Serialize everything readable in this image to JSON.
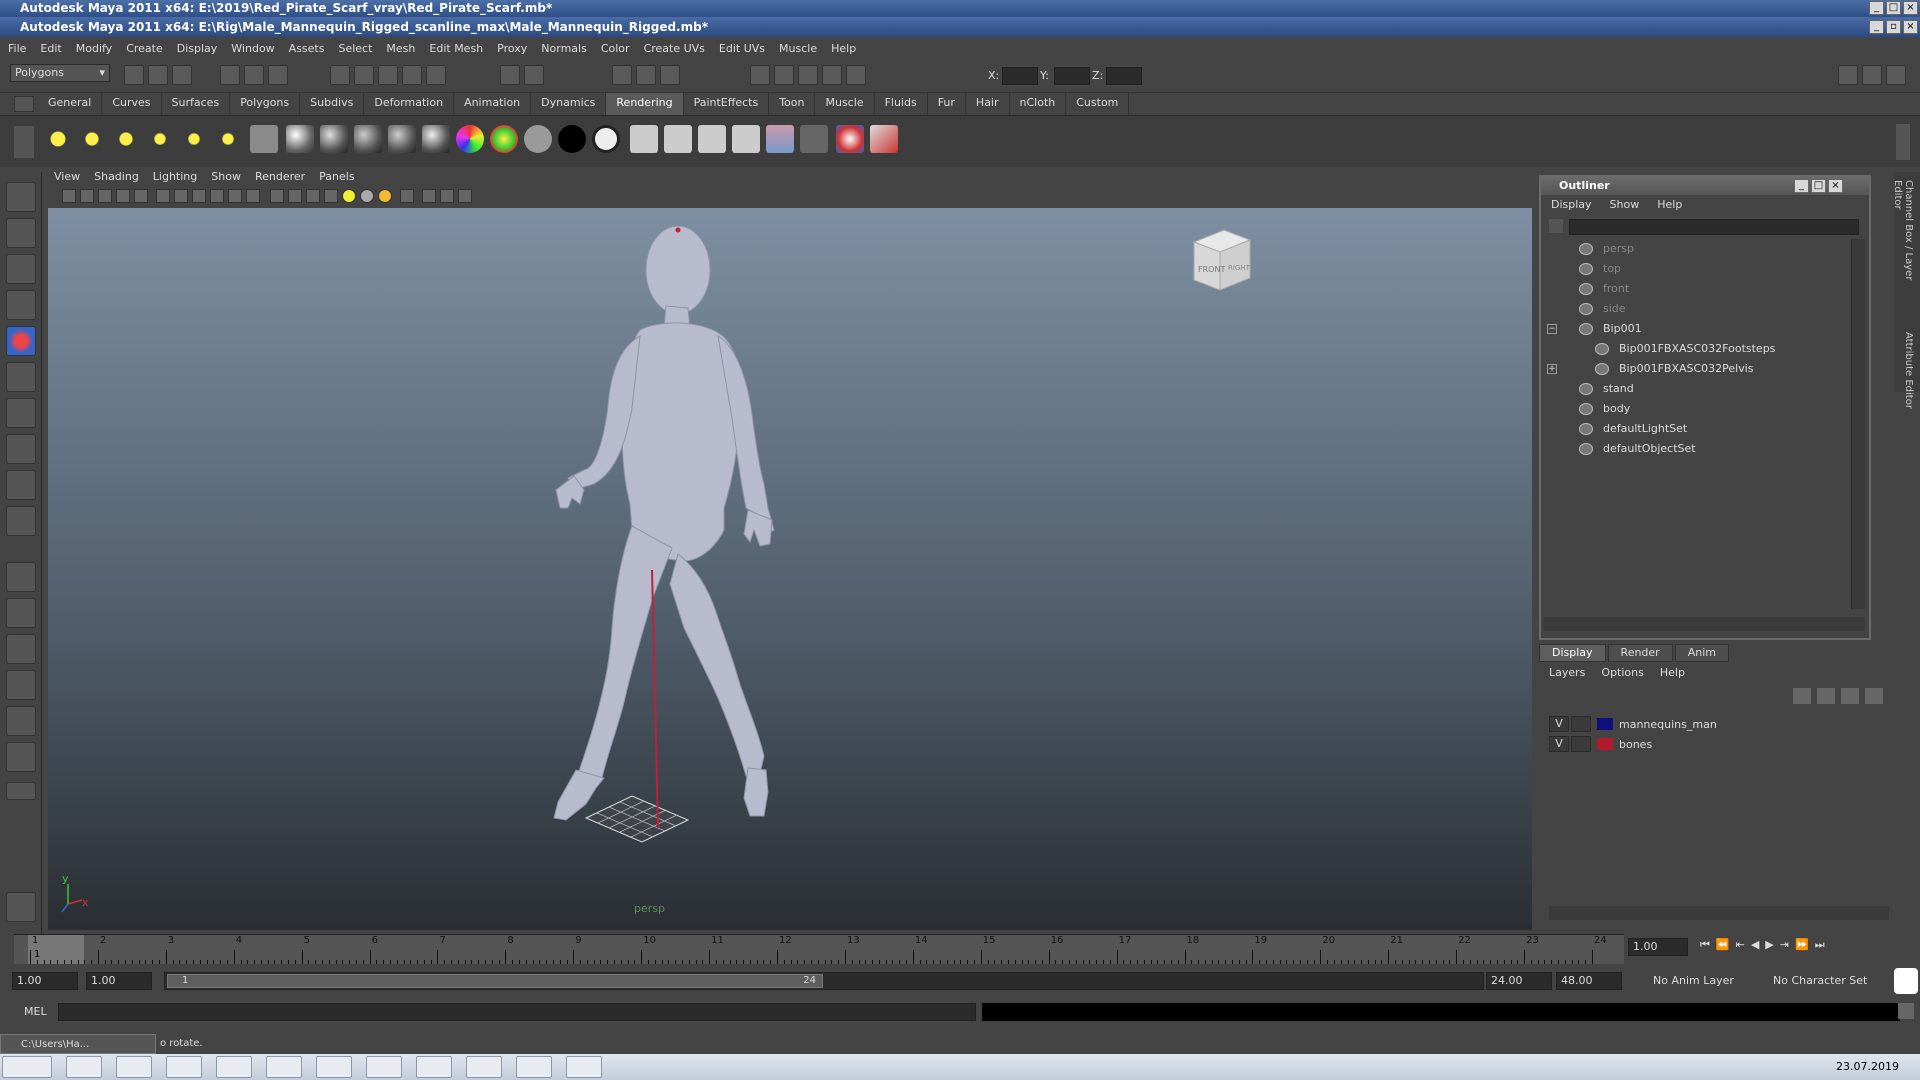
{
  "outer_title": "Autodesk Maya 2011 x64: E:\\2019\\Red_Pirate_Scarf_vray\\Red_Pirate_Scarf.mb*",
  "inner_title": "Autodesk Maya 2011 x64: E:\\Rig\\Male_Mannequin_Rigged_scanline_max\\Male_Mannequin_Rigged.mb*",
  "menubar": [
    "File",
    "Edit",
    "Modify",
    "Create",
    "Display",
    "Window",
    "Assets",
    "Select",
    "Mesh",
    "Edit Mesh",
    "Proxy",
    "Normals",
    "Color",
    "Create UVs",
    "Edit UVs",
    "Muscle",
    "Help"
  ],
  "menuset": "Polygons",
  "coord_labels": {
    "x": "X:",
    "y": "Y:",
    "z": "Z:"
  },
  "shelf_tabs": [
    "General",
    "Curves",
    "Surfaces",
    "Polygons",
    "Subdivs",
    "Deformation",
    "Animation",
    "Dynamics",
    "Rendering",
    "PaintEffects",
    "Toon",
    "Muscle",
    "Fluids",
    "Fur",
    "Hair",
    "nCloth",
    "Custom"
  ],
  "active_shelf": "Rendering",
  "viewport": {
    "menu": [
      "View",
      "Shading",
      "Lighting",
      "Show",
      "Renderer",
      "Panels"
    ],
    "camera_label": "persp",
    "viewcube": {
      "front": "FRONT",
      "right": "RIGHT"
    },
    "axis": {
      "y": "y",
      "x": "x"
    }
  },
  "outliner": {
    "title": "Outliner",
    "menu": [
      "Display",
      "Show",
      "Help"
    ],
    "items": [
      {
        "label": "persp",
        "dim": true
      },
      {
        "label": "top",
        "dim": true
      },
      {
        "label": "front",
        "dim": true
      },
      {
        "label": "side",
        "dim": true
      },
      {
        "label": "Bip001",
        "dim": false
      },
      {
        "label": "Bip001FBXASC032Footsteps",
        "dim": false
      },
      {
        "label": "Bip001FBXASC032Pelvis",
        "dim": false
      },
      {
        "label": "stand",
        "dim": false
      },
      {
        "label": "body",
        "dim": false
      },
      {
        "label": "defaultLightSet",
        "dim": false
      },
      {
        "label": "defaultObjectSet",
        "dim": false
      }
    ]
  },
  "side_tabs": {
    "channel_box": "Channel Box / Layer Editor",
    "attribute_editor": "Attribute Editor"
  },
  "layer_editor": {
    "tabs": [
      "Display",
      "Render",
      "Anim"
    ],
    "menu": [
      "Layers",
      "Options",
      "Help"
    ],
    "layers": [
      {
        "v": "V",
        "name": "mannequins_man",
        "color": "#10107a"
      },
      {
        "v": "V",
        "name": "bones",
        "color": "#b01a2a"
      }
    ]
  },
  "timeline": {
    "frames": [
      "1",
      "2",
      "3",
      "4",
      "5",
      "6",
      "7",
      "8",
      "9",
      "10",
      "11",
      "12",
      "13",
      "14",
      "15",
      "16",
      "17",
      "18",
      "19",
      "20",
      "21",
      "22",
      "23",
      "24"
    ],
    "current_frame": "1",
    "current_time_field": "1.00"
  },
  "range": {
    "start": "1.00",
    "playback_start": "1.00",
    "slider_start": "1",
    "slider_end": "24",
    "playback_end": "24.00",
    "end": "48.00",
    "anim_layer": "No Anim Layer",
    "character_set": "No Character Set"
  },
  "command": {
    "label": "MEL"
  },
  "helpline": {
    "text": "o rotate.",
    "window_label": "C:\\Users\\Ha..."
  },
  "taskbar": {
    "date": "23.07.2019"
  },
  "colors": {
    "accent_blue": "#2e4f87",
    "mesh": "#b9bdd0",
    "joint_red": "#c0203a"
  }
}
